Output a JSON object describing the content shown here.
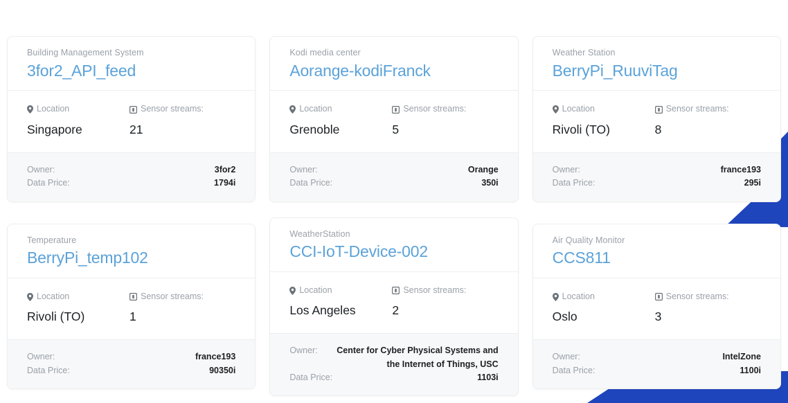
{
  "theme": {
    "accent_blue": "#1f45bd",
    "title_link": "#5ba2d9",
    "label_gray": "#9aa1a9",
    "value_black": "#1b1f23",
    "footer_bg": "#f7f8f9",
    "card_border": "#eceef0",
    "page_bg": "#ffffff"
  },
  "labels": {
    "location": "Location",
    "sensor_streams": "Sensor streams:",
    "owner": "Owner:",
    "data_price": "Data Price:"
  },
  "icons": {
    "location": "location-pin-icon",
    "sensor": "sensor-stream-icon"
  },
  "cards": [
    {
      "kind": "Building Management System",
      "title": "3for2_API_feed",
      "location": "Singapore",
      "sensor_streams": "21",
      "owner": "3for2",
      "data_price": "1794i",
      "wrap_owner": false
    },
    {
      "kind": "Kodi media center",
      "title": "Aorange-kodiFranck",
      "location": "Grenoble",
      "sensor_streams": "5",
      "owner": "Orange",
      "data_price": "350i",
      "wrap_owner": false
    },
    {
      "kind": "Weather Station",
      "title": "BerryPi_RuuviTag",
      "location": "Rivoli (TO)",
      "sensor_streams": "8",
      "owner": "france193",
      "data_price": "295i",
      "wrap_owner": false
    },
    {
      "kind": "Temperature",
      "title": "BerryPi_temp102",
      "location": "Rivoli (TO)",
      "sensor_streams": "1",
      "owner": "france193",
      "data_price": "90350i",
      "wrap_owner": false
    },
    {
      "kind": "WeatherStation",
      "title": "CCI-IoT-Device-002",
      "location": "Los Angeles",
      "sensor_streams": "2",
      "owner": "Center for Cyber Physical Systems and the Internet of Things, USC",
      "data_price": "1103i",
      "wrap_owner": true
    },
    {
      "kind": "Air Quality Monitor",
      "title": "CCS811",
      "location": "Oslo",
      "sensor_streams": "3",
      "owner": "IntelZone",
      "data_price": "1100i",
      "wrap_owner": false
    }
  ]
}
